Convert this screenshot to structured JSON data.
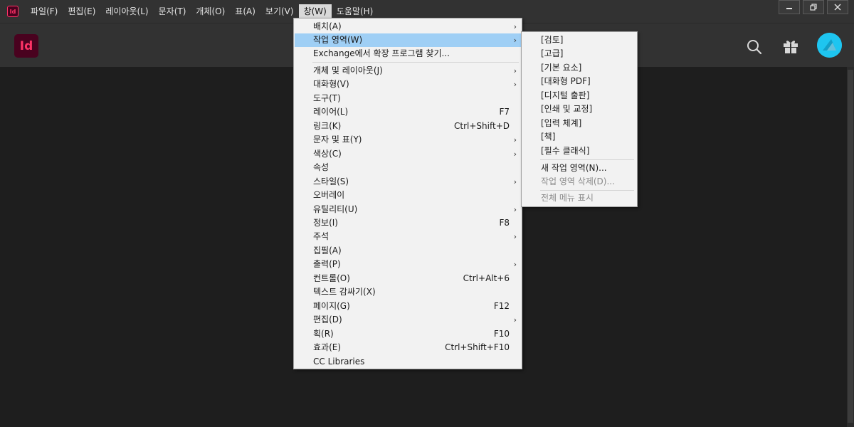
{
  "menubar": {
    "items": [
      "파일(F)",
      "편집(E)",
      "레이아웃(L)",
      "문자(T)",
      "개체(O)",
      "표(A)",
      "보기(V)",
      "창(W)",
      "도움말(H)"
    ],
    "active_index": 7,
    "app_icon": "Id"
  },
  "header": {
    "logo": "Id",
    "search_icon": "search-icon",
    "gift_icon": "gift-icon",
    "avatar_color": "#1ec5f0"
  },
  "window_menu": {
    "items": [
      {
        "label": "배치(A)",
        "submenu": true
      },
      {
        "label": "작업 영역(W)",
        "submenu": true,
        "highlighted": true
      },
      {
        "label": "Exchange에서 확장 프로그램 찾기..."
      },
      {
        "label": "개체 및 레이아웃(J)",
        "submenu": true
      },
      {
        "label": "대화형(V)",
        "submenu": true
      },
      {
        "label": "도구(T)"
      },
      {
        "label": "레이어(L)",
        "shortcut": "F7"
      },
      {
        "label": "링크(K)",
        "shortcut": "Ctrl+Shift+D"
      },
      {
        "label": "문자 및 표(Y)",
        "submenu": true
      },
      {
        "label": "색상(C)",
        "submenu": true
      },
      {
        "label": "속성"
      },
      {
        "label": "스타일(S)",
        "submenu": true
      },
      {
        "label": "오버레이"
      },
      {
        "label": "유틸리티(U)",
        "submenu": true
      },
      {
        "label": "정보(I)",
        "shortcut": "F8"
      },
      {
        "label": "주석",
        "submenu": true
      },
      {
        "label": "집필(A)"
      },
      {
        "label": "출력(P)",
        "submenu": true
      },
      {
        "label": "컨트롤(O)",
        "shortcut": "Ctrl+Alt+6"
      },
      {
        "label": "텍스트 감싸기(X)"
      },
      {
        "label": "페이지(G)",
        "shortcut": "F12"
      },
      {
        "label": "편집(D)",
        "submenu": true
      },
      {
        "label": "획(R)",
        "shortcut": "F10"
      },
      {
        "label": "효과(E)",
        "shortcut": "Ctrl+Shift+F10"
      },
      {
        "label": "CC Libraries"
      }
    ]
  },
  "workspace_submenu": {
    "items": [
      {
        "label": "[검토]"
      },
      {
        "label": "[고급]"
      },
      {
        "label": "[기본 요소]"
      },
      {
        "label": "[대화형 PDF]"
      },
      {
        "label": "[디지털 출판]"
      },
      {
        "label": "[인쇄 및 교정]"
      },
      {
        "label": "[입력 체계]"
      },
      {
        "label": "[책]"
      },
      {
        "label": "[필수 클래식]"
      },
      {
        "label": "새 작업 영역(N)..."
      },
      {
        "label": "작업 영역 삭제(D)...",
        "disabled": true
      },
      {
        "label": "전체 메뉴 표시",
        "disabled": true
      }
    ]
  },
  "window_controls": {
    "minimize": "minimize-icon",
    "restore": "restore-icon",
    "close": "close-icon"
  }
}
